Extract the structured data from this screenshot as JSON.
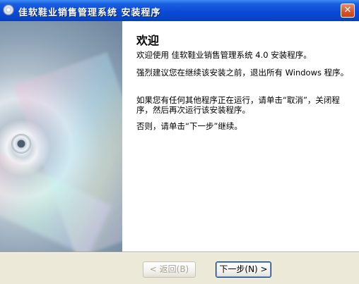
{
  "window": {
    "title": "佳软鞋业销售管理系统  安装程序",
    "close_label": "✕"
  },
  "content": {
    "heading": "欢迎",
    "paragraphs": [
      "欢迎使用 佳软鞋业销售管理系统 4.0 安装程序。",
      "强烈建议您在继续该安装之前，退出所有 Windows 程序。",
      "如果您有任何其他程序正在运行，请单击“取消”，关闭程序，然后再次运行该安装程序。",
      "否则，请单击“下一步”继续。"
    ]
  },
  "buttons": {
    "back_label": "< 返回(B)",
    "next_label": "下一步(N) >"
  }
}
